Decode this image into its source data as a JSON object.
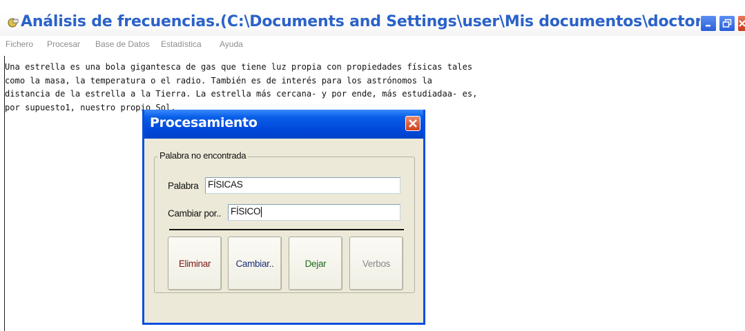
{
  "window": {
    "title": "Análisis de frecuencias.(C:\\Documents and Settings\\user\\Mis documentos\\doctorado\\casos-estudio\\e...",
    "menu": [
      "Fichero",
      "Procesar",
      "Base de Datos",
      "Estadística",
      "Ayuda"
    ]
  },
  "document": {
    "lines": [
      "Una estrella es una bola gigantesca de gas que tiene luz propia con propiedades físicas tales",
      "como la masa, la temperatura o el radio. También es de interés para los astrónomos la",
      "distancia de la estrella a la Tierra. La estrella más cercana- y por ende, más estudiadaa- es,",
      "por supuesto1, nuestro propio Sol."
    ]
  },
  "dialog": {
    "title": "Procesamiento",
    "group_title": "Palabra no encontrada",
    "word_label": "Palabra",
    "word_value": "FÍSICAS",
    "replace_label": "Cambiar por..",
    "replace_value": "FÍSICO",
    "buttons": {
      "delete": "Eliminar",
      "change": "Cambiar..",
      "keep": "Dejar",
      "verbs": "Verbos"
    }
  },
  "colors": {
    "title_text": "#2b62c9",
    "dialog_title_bar": "#0047d9",
    "dialog_body": "#ece9d8",
    "delete_text": "#7b1713",
    "change_text": "#1d2d7a",
    "keep_text": "#1d6b1d",
    "disabled_text": "#8a8a8a"
  }
}
